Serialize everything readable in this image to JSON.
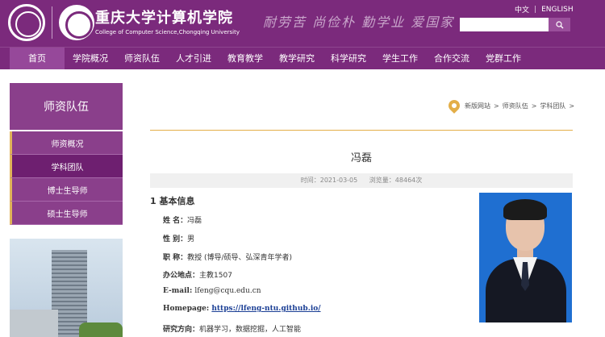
{
  "header": {
    "school_cn": "重庆大学计算机学院",
    "school_en": "College of Computer Science,Chongqing University",
    "motto": "耐劳苦 尚俭朴 勤学业 爱国家",
    "lang_cn": "中文",
    "lang_en": "ENGLISH",
    "search_placeholder": ""
  },
  "nav": [
    "首页",
    "学院概况",
    "师资队伍",
    "人才引进",
    "教育教学",
    "教学研究",
    "科学研究",
    "学生工作",
    "合作交流",
    "党群工作"
  ],
  "sidebar": {
    "title": "师资队伍",
    "items": [
      "师资概况",
      "学科团队",
      "博士生导师",
      "硕士生导师"
    ],
    "active_index": 1
  },
  "breadcrumb": [
    "新版网站",
    "师资队伍",
    "学科团队"
  ],
  "breadcrumb_sep": ">",
  "article": {
    "title": "冯磊",
    "time_label": "时间：2021-03-05",
    "views_label": "浏览量：48464次",
    "section": "1 基本信息",
    "info": [
      {
        "k": "姓    名：",
        "v": "冯磊"
      },
      {
        "k": "性    别：",
        "v": "男"
      },
      {
        "k": "职    称：",
        "v": "教授 (博导/硕导、弘深青年学者)"
      },
      {
        "k": "办公地点：",
        "v": "主教1507"
      },
      {
        "k": "E-mail: ",
        "v": "lfeng@cqu.edu.cn"
      },
      {
        "k": "Homepage: ",
        "v": "https://lfeng-ntu.github.io/"
      },
      {
        "k": "研究方向：",
        "v": "机器学习，数据挖掘，人工智能"
      }
    ]
  },
  "colors": {
    "brand_purple": "#7b2a7c",
    "accent_gold": "#e3ae48",
    "link_blue": "#1b3f95"
  }
}
